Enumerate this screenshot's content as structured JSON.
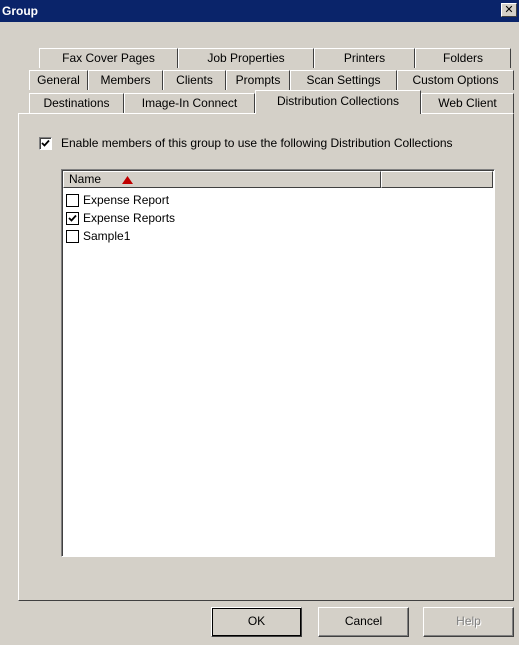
{
  "window": {
    "title": "Group",
    "close_glyph": "✕"
  },
  "tabs": [
    {
      "label": "Fax Cover Pages",
      "active": false
    },
    {
      "label": "Job Properties",
      "active": false
    },
    {
      "label": "Printers",
      "active": false
    },
    {
      "label": "Folders",
      "active": false
    },
    {
      "label": "General",
      "active": false
    },
    {
      "label": "Members",
      "active": false
    },
    {
      "label": "Clients",
      "active": false
    },
    {
      "label": "Prompts",
      "active": false
    },
    {
      "label": "Scan Settings",
      "active": false
    },
    {
      "label": "Custom Options",
      "active": false
    },
    {
      "label": "Destinations",
      "active": false
    },
    {
      "label": "Image-In Connect",
      "active": false
    },
    {
      "label": "Distribution Collections",
      "active": true
    },
    {
      "label": "Web Client",
      "active": false
    }
  ],
  "panel": {
    "enable_checkbox": {
      "label": "Enable members of this group to use the following Distribution Collections",
      "checked": true
    },
    "list": {
      "columns": [
        {
          "label": "Name",
          "sort": "ascending"
        },
        {
          "label": ""
        }
      ],
      "items": [
        {
          "label": "Expense Report",
          "checked": false
        },
        {
          "label": "Expense Reports",
          "checked": true
        },
        {
          "label": "Sample1",
          "checked": false
        }
      ]
    }
  },
  "buttons": {
    "ok": "OK",
    "cancel": "Cancel",
    "help": "Help"
  },
  "colors": {
    "titlebar": "#0a246a",
    "face": "#d4d0c8",
    "sort_arrow": "#c00000"
  }
}
